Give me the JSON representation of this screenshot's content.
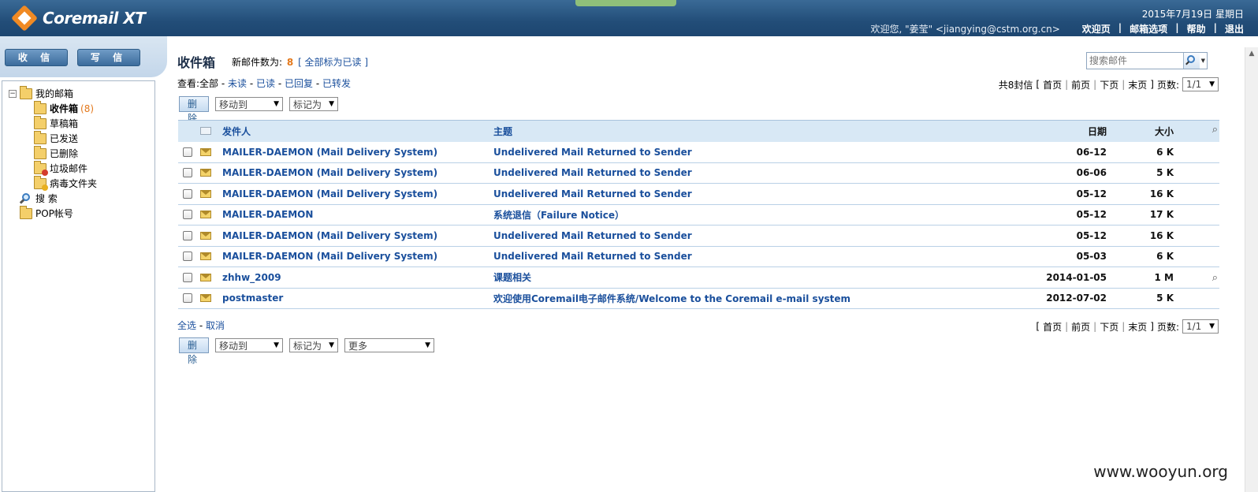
{
  "app": {
    "logo_text": "Coremail XT"
  },
  "header": {
    "date": "2015年7月19日 星期日",
    "welcome": "欢迎您, \"姜莹\" <jiangying@cstm.org.cn>",
    "nav": [
      "欢迎页",
      "邮箱选项",
      "帮助",
      "退出"
    ]
  },
  "sidebar": {
    "receive_label": "收 信",
    "compose_label": "写 信",
    "root_label": "我的邮箱",
    "folders": [
      {
        "label": "收件箱",
        "count": "(8)"
      },
      {
        "label": "草稿箱"
      },
      {
        "label": "已发送"
      },
      {
        "label": "已删除"
      },
      {
        "label": "垃圾邮件"
      },
      {
        "label": "病毒文件夹"
      }
    ],
    "search_label": "搜 索",
    "pop_label": "POP帐号"
  },
  "main": {
    "title": "收件箱",
    "new_mail_label": "新邮件数为:",
    "new_mail_count": "8",
    "mark_all_read": "[ 全部标为已读 ]",
    "view_label": "查看:",
    "view_all": "全部",
    "view_filters": [
      "未读",
      "已读",
      "已回复",
      "已转发"
    ],
    "search_placeholder": "搜索邮件",
    "pager": {
      "total": "共8封信",
      "first": "首页",
      "prev": "前页",
      "next": "下页",
      "last": "末页",
      "pages_label": "页数:",
      "page_value": "1/1"
    },
    "toolbar": {
      "delete_label": "删 除",
      "move_to": "移动到",
      "mark_as": "标记为",
      "more": "更多"
    },
    "columns": {
      "from": "发件人",
      "subject": "主题",
      "date": "日期",
      "size": "大小"
    },
    "rows": [
      {
        "from": "MAILER-DAEMON (Mail Delivery System)",
        "subject": "Undelivered Mail Returned to Sender",
        "date": "06-12",
        "size": "6 K",
        "attach": false
      },
      {
        "from": "MAILER-DAEMON (Mail Delivery System)",
        "subject": "Undelivered Mail Returned to Sender",
        "date": "06-06",
        "size": "5 K",
        "attach": false
      },
      {
        "from": "MAILER-DAEMON (Mail Delivery System)",
        "subject": "Undelivered Mail Returned to Sender",
        "date": "05-12",
        "size": "16 K",
        "attach": false
      },
      {
        "from": "MAILER-DAEMON",
        "subject": "系统退信（Failure Notice）",
        "date": "05-12",
        "size": "17 K",
        "attach": false
      },
      {
        "from": "MAILER-DAEMON (Mail Delivery System)",
        "subject": "Undelivered Mail Returned to Sender",
        "date": "05-12",
        "size": "16 K",
        "attach": false
      },
      {
        "from": "MAILER-DAEMON (Mail Delivery System)",
        "subject": "Undelivered Mail Returned to Sender",
        "date": "05-03",
        "size": "6 K",
        "attach": false
      },
      {
        "from": "zhhw_2009",
        "subject": "课题相关",
        "date": "2014-01-05",
        "size": "1 M",
        "attach": true
      },
      {
        "from": "postmaster",
        "subject": "欢迎使用Coremail电子邮件系统/Welcome to the Coremail e-mail system",
        "date": "2012-07-02",
        "size": "5 K",
        "attach": false
      }
    ],
    "select_all": "全选",
    "cancel": "取消"
  },
  "watermark": "www.wooyun.org"
}
